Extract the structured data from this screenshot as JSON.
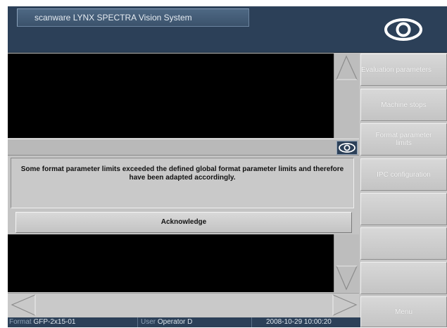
{
  "window": {
    "title": "scanware LYNX SPECTRA Vision System"
  },
  "message": {
    "text": "Some format parameter limits exceeded the defined global format parameter limits and therefore have been adapted accordingly."
  },
  "acknowledge_label": "Acknowledge",
  "status": {
    "format_label": "Format",
    "format_value": "GFP-2x15-01",
    "user_label": "User",
    "user_value": "Operator D",
    "datetime": "2008-10-29 10:00:20"
  },
  "sidebar": {
    "logo_icon": "eye-icon",
    "buttons": [
      {
        "label": "Evaluation parameters"
      },
      {
        "label": "Machine stops"
      },
      {
        "label": "Format parameter limits"
      },
      {
        "label": "IPC configuration"
      },
      {
        "label": ""
      },
      {
        "label": ""
      },
      {
        "label": ""
      },
      {
        "label": "Menu"
      }
    ]
  },
  "colors": {
    "header_blue": "#2c4058",
    "panel_gray": "#c4c4c4",
    "button_text": "#f7f7f7"
  }
}
